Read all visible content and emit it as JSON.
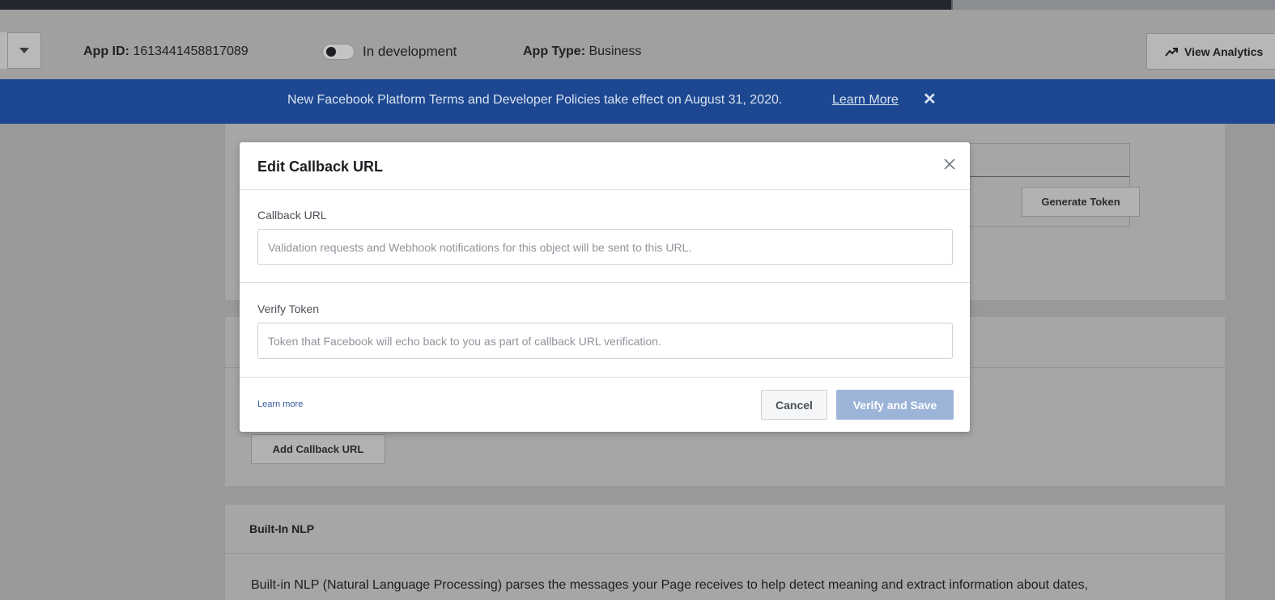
{
  "header": {
    "app_id_label": "App ID:",
    "app_id_value": "1613441458817089",
    "mode_label": "In development",
    "app_type_label": "App Type:",
    "app_type_value": "Business",
    "analytics_label": "View Analytics"
  },
  "banner": {
    "text": "New Facebook Platform Terms and Developer Policies take effect on August 31, 2020.",
    "link": "Learn More",
    "close": "✕"
  },
  "background": {
    "generate_token": "Generate Token",
    "add_callback": "Add Callback URL",
    "nlp_title": "Built-In NLP",
    "nlp_desc": "Built-in NLP (Natural Language Processing) parses the messages your Page receives to help detect meaning and extract information about dates,"
  },
  "modal": {
    "title": "Edit Callback URL",
    "callback_label": "Callback URL",
    "callback_placeholder": "Validation requests and Webhook notifications for this object will be sent to this URL.",
    "callback_value": "",
    "token_label": "Verify Token",
    "token_placeholder": "Token that Facebook will echo back to you as part of callback URL verification.",
    "token_value": "",
    "learn_more": "Learn more",
    "cancel": "Cancel",
    "verify_save": "Verify and Save"
  },
  "colors": {
    "banner": "#1d4891",
    "link": "#365899",
    "primary_disabled": "#9cb4d8"
  }
}
